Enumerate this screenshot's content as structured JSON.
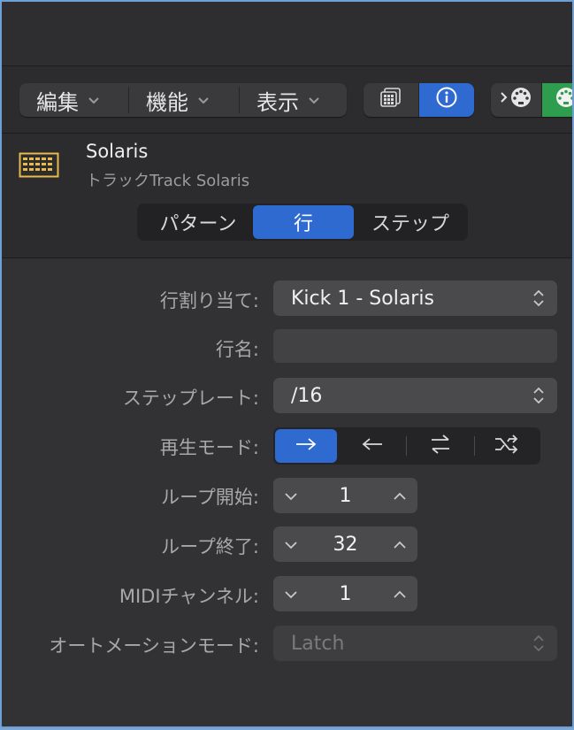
{
  "toolbar": {
    "menus": [
      {
        "label": "編集"
      },
      {
        "label": "機能"
      },
      {
        "label": "表示"
      }
    ],
    "chevron": "⌄"
  },
  "track": {
    "name": "Solaris",
    "subtitle": "トラックTrack Solaris",
    "icon_color": "#e9b949"
  },
  "tabs": [
    {
      "label": "パターン"
    },
    {
      "label": "行",
      "selected": true
    },
    {
      "label": "ステップ"
    }
  ],
  "inspector": {
    "row_assignment": {
      "label": "行割り当て:",
      "value": "Kick 1 - Solaris"
    },
    "row_name": {
      "label": "行名:",
      "value": ""
    },
    "step_rate": {
      "label": "ステップレート:",
      "value": "/16"
    },
    "playback_mode": {
      "label": "再生モード:",
      "options": [
        "forward",
        "backward",
        "ping-pong",
        "random"
      ],
      "selected": "forward"
    },
    "loop_start": {
      "label": "ループ開始:",
      "value": "1"
    },
    "loop_end": {
      "label": "ループ終了:",
      "value": "32"
    },
    "midi_channel": {
      "label": "MIDIチャンネル:",
      "value": "1"
    },
    "automation_mode": {
      "label": "オートメーションモード:",
      "value": "Latch",
      "enabled": false
    }
  },
  "colors": {
    "accent": "#2f6ad0",
    "plugin_green": "#2e9e4e"
  }
}
